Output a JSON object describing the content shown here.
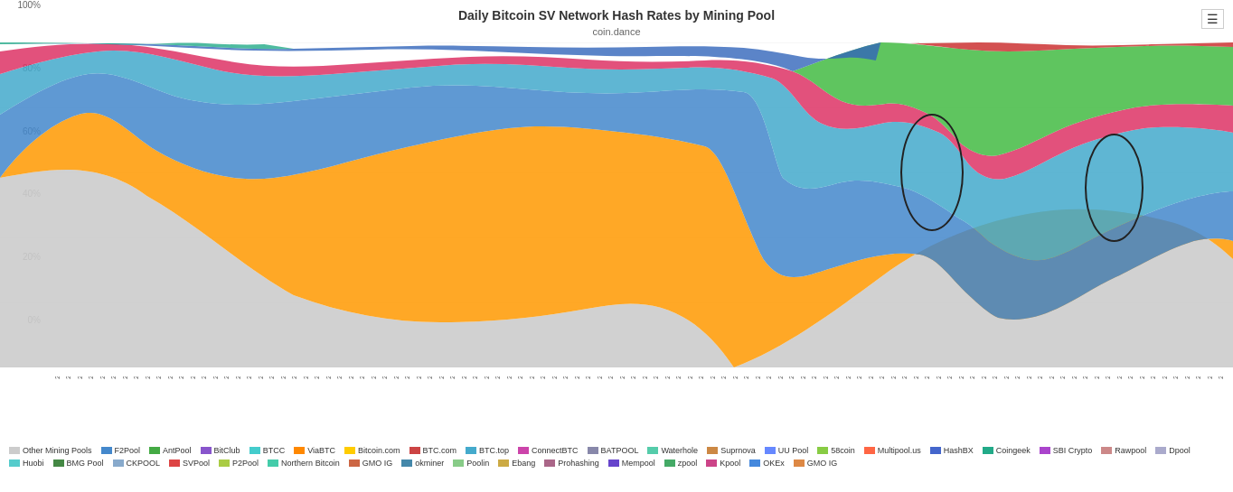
{
  "header": {
    "title": "Daily Bitcoin SV Network Hash Rates by Mining Pool",
    "subtitle": "coin.dance"
  },
  "menu_icon": "☰",
  "y_axis": {
    "labels": [
      "100%",
      "80%",
      "60%",
      "40%",
      "20%",
      "0%"
    ]
  },
  "legend": {
    "items": [
      {
        "label": "Other Mining Pools",
        "color": "#cccccc"
      },
      {
        "label": "F2Pool",
        "color": "#4488cc"
      },
      {
        "label": "AntPool",
        "color": "#44aa44"
      },
      {
        "label": "BitClub",
        "color": "#8855cc"
      },
      {
        "label": "BTCC",
        "color": "#44cccc"
      },
      {
        "label": "ViaBTC",
        "color": "#ff8800"
      },
      {
        "label": "Bitcoin.com",
        "color": "#ffcc00"
      },
      {
        "label": "BTC.com",
        "color": "#cc4444"
      },
      {
        "label": "BTC.top",
        "color": "#44aacc"
      },
      {
        "label": "ConnectBTC",
        "color": "#cc44aa"
      },
      {
        "label": "BATPOOL",
        "color": "#8888aa"
      },
      {
        "label": "Waterhole",
        "color": "#55ccaa"
      },
      {
        "label": "Suprnova",
        "color": "#cc8844"
      },
      {
        "label": "UU Pool",
        "color": "#6688ff"
      },
      {
        "label": "58coin",
        "color": "#88cc44"
      },
      {
        "label": "Multipool.us",
        "color": "#ff6644"
      },
      {
        "label": "HashBX",
        "color": "#4466cc"
      },
      {
        "label": "Coingeek",
        "color": "#22aa88"
      },
      {
        "label": "SBI Crypto",
        "color": "#aa44cc"
      },
      {
        "label": "Rawpool",
        "color": "#cc8888"
      },
      {
        "label": "Dpool",
        "color": "#aaaacc"
      },
      {
        "label": "Huobi",
        "color": "#55cccc"
      },
      {
        "label": "BMG Pool",
        "color": "#448844"
      },
      {
        "label": "CKPOOL",
        "color": "#88aacc"
      },
      {
        "label": "SVPool",
        "color": "#dd4444"
      },
      {
        "label": "P2Pool",
        "color": "#aacc44"
      },
      {
        "label": "Northern Bitcoin",
        "color": "#44ccaa"
      },
      {
        "label": "GMO IG",
        "color": "#cc6644"
      },
      {
        "label": "okminer",
        "color": "#4488aa"
      },
      {
        "label": "Poolin",
        "color": "#88cc88"
      },
      {
        "label": "Ebang",
        "color": "#ccaa44"
      },
      {
        "label": "Prohashing",
        "color": "#aa6688"
      },
      {
        "label": "Mempool",
        "color": "#6644cc"
      },
      {
        "label": "zpool",
        "color": "#44aa66"
      },
      {
        "label": "Kpool",
        "color": "#cc4488"
      },
      {
        "label": "OKEx",
        "color": "#4488dd"
      },
      {
        "label": "GMO IG",
        "color": "#dd8844"
      }
    ]
  }
}
